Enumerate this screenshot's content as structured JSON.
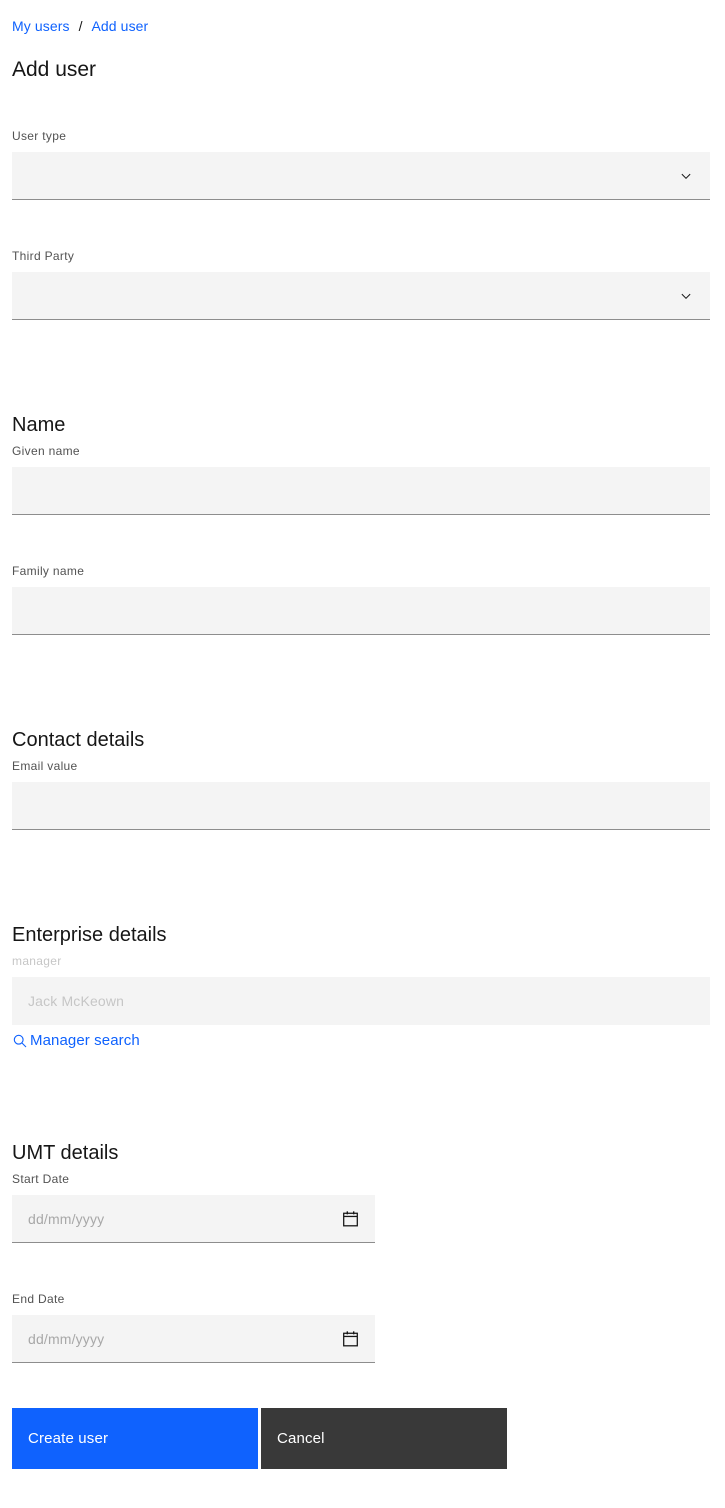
{
  "breadcrumb": {
    "items": [
      {
        "label": "My users"
      },
      {
        "label": "Add user"
      }
    ],
    "separator": "/"
  },
  "page": {
    "title": "Add user"
  },
  "form": {
    "user_type": {
      "label": "User type",
      "value": "",
      "icon": "chevron-down-icon"
    },
    "third_party": {
      "label": "Third Party",
      "value": "",
      "icon": "chevron-down-icon"
    },
    "name_section": {
      "heading": "Name",
      "given_name": {
        "label": "Given name",
        "value": "",
        "placeholder": ""
      },
      "family_name": {
        "label": "Family name",
        "value": "",
        "placeholder": ""
      }
    },
    "contact_section": {
      "heading": "Contact details",
      "email": {
        "label": "Email value",
        "value": "",
        "placeholder": ""
      }
    },
    "enterprise_section": {
      "heading": "Enterprise details",
      "manager": {
        "label": "manager",
        "value": "",
        "placeholder": "Jack McKeown",
        "disabled": true
      },
      "manager_search_link": {
        "label": "Manager search",
        "icon": "search-icon"
      }
    },
    "umt_section": {
      "heading": "UMT details",
      "start_date": {
        "label": "Start Date",
        "value": "",
        "placeholder": "dd/mm/yyyy",
        "icon": "calendar-icon"
      },
      "end_date": {
        "label": "End Date",
        "value": "",
        "placeholder": "dd/mm/yyyy",
        "icon": "calendar-icon"
      }
    }
  },
  "actions": {
    "create": "Create user",
    "cancel": "Cancel"
  },
  "colors": {
    "link_blue": "#0f62fe",
    "primary_button": "#0f62fe",
    "secondary_button": "#393939",
    "field_background": "#f4f4f4",
    "field_border": "#8d8d8d",
    "label_gray": "#525252",
    "disabled_gray": "#c6c6c6",
    "placeholder_gray": "#a8a8a8",
    "text_dark": "#161616"
  }
}
